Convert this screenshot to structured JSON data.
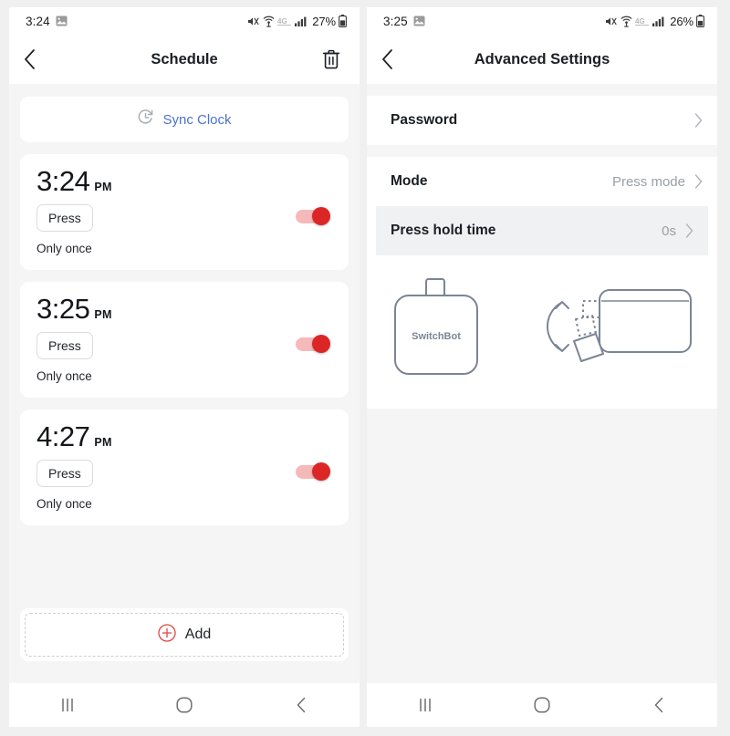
{
  "left_phone": {
    "status_bar": {
      "time": "3:24",
      "battery_percent": "27%",
      "icons": [
        "photo-icon",
        "mute-icon",
        "hotspot-icon",
        "4g-icon",
        "signal-icon",
        "battery-icon"
      ]
    },
    "title": "Schedule",
    "back_icon": "chevron-left-icon",
    "delete_icon": "trash-icon",
    "sync": {
      "label": "Sync Clock",
      "icon": "clock-refresh-icon",
      "color": "#4a72d0"
    },
    "schedules": [
      {
        "time": "3:24",
        "ampm": "PM",
        "action": "Press",
        "repeat": "Only once",
        "enabled": true
      },
      {
        "time": "3:25",
        "ampm": "PM",
        "action": "Press",
        "repeat": "Only once",
        "enabled": true
      },
      {
        "time": "4:27",
        "ampm": "PM",
        "action": "Press",
        "repeat": "Only once",
        "enabled": true
      }
    ],
    "add": {
      "label": "Add",
      "icon": "plus-circle-icon",
      "color": "#e04646"
    },
    "nav": {
      "recents": "recents-icon",
      "home": "home-icon",
      "back": "back-icon"
    }
  },
  "right_phone": {
    "status_bar": {
      "time": "3:25",
      "battery_percent": "26%",
      "icons": [
        "photo-icon",
        "mute-icon",
        "hotspot-icon",
        "4g-icon",
        "signal-icon",
        "battery-icon"
      ]
    },
    "title": "Advanced Settings",
    "back_icon": "chevron-left-icon",
    "rows_group_1": [
      {
        "label": "Password",
        "value": "",
        "pressed": false
      }
    ],
    "rows_group_2": [
      {
        "label": "Mode",
        "value": "Press mode",
        "pressed": false
      },
      {
        "label": "Press hold time",
        "value": "0s",
        "pressed": true
      }
    ],
    "illustration": {
      "device_label": "SwitchBot",
      "stroke_color": "#7b8594"
    },
    "nav": {
      "recents": "recents-icon",
      "home": "home-icon",
      "back": "back-icon"
    }
  }
}
